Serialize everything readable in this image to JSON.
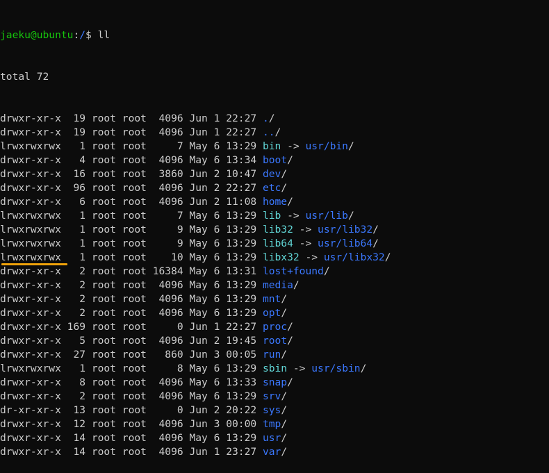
{
  "prompt": {
    "user_host": "jaeku@ubuntu",
    "separator": ":",
    "path": "/",
    "symbol": "$ ",
    "command": "ll"
  },
  "total_line": "total 72",
  "colors": {
    "background": "#0c0c0c",
    "text": "#cccccc",
    "prompt_user": "#16c60c",
    "directory": "#3b78ff",
    "symlink": "#61d6d6",
    "highlight_underline": "#f0a30a"
  },
  "entries": [
    {
      "perms": "drwxr-xr-x",
      "links": "19",
      "owner": "root",
      "group": "root",
      "size": "4096",
      "month": "Jun",
      "day": "1",
      "time": "22:27",
      "name": ".",
      "type": "dir"
    },
    {
      "perms": "drwxr-xr-x",
      "links": "19",
      "owner": "root",
      "group": "root",
      "size": "4096",
      "month": "Jun",
      "day": "1",
      "time": "22:27",
      "name": "..",
      "type": "dir"
    },
    {
      "perms": "lrwxrwxrwx",
      "links": "1",
      "owner": "root",
      "group": "root",
      "size": "7",
      "month": "May",
      "day": "6",
      "time": "13:29",
      "name": "bin",
      "type": "link",
      "target": "usr/bin"
    },
    {
      "perms": "drwxr-xr-x",
      "links": "4",
      "owner": "root",
      "group": "root",
      "size": "4096",
      "month": "May",
      "day": "6",
      "time": "13:34",
      "name": "boot",
      "type": "dir"
    },
    {
      "perms": "drwxr-xr-x",
      "links": "16",
      "owner": "root",
      "group": "root",
      "size": "3860",
      "month": "Jun",
      "day": "2",
      "time": "10:47",
      "name": "dev",
      "type": "dir"
    },
    {
      "perms": "drwxr-xr-x",
      "links": "96",
      "owner": "root",
      "group": "root",
      "size": "4096",
      "month": "Jun",
      "day": "2",
      "time": "22:27",
      "name": "etc",
      "type": "dir"
    },
    {
      "perms": "drwxr-xr-x",
      "links": "6",
      "owner": "root",
      "group": "root",
      "size": "4096",
      "month": "Jun",
      "day": "2",
      "time": "11:08",
      "name": "home",
      "type": "dir"
    },
    {
      "perms": "lrwxrwxrwx",
      "links": "1",
      "owner": "root",
      "group": "root",
      "size": "7",
      "month": "May",
      "day": "6",
      "time": "13:29",
      "name": "lib",
      "type": "link",
      "target": "usr/lib"
    },
    {
      "perms": "lrwxrwxrwx",
      "links": "1",
      "owner": "root",
      "group": "root",
      "size": "9",
      "month": "May",
      "day": "6",
      "time": "13:29",
      "name": "lib32",
      "type": "link",
      "target": "usr/lib32"
    },
    {
      "perms": "lrwxrwxrwx",
      "links": "1",
      "owner": "root",
      "group": "root",
      "size": "9",
      "month": "May",
      "day": "6",
      "time": "13:29",
      "name": "lib64",
      "type": "link",
      "target": "usr/lib64"
    },
    {
      "perms": "lrwxrwxrwx",
      "links": "1",
      "owner": "root",
      "group": "root",
      "size": "10",
      "month": "May",
      "day": "6",
      "time": "13:29",
      "name": "libx32",
      "type": "link",
      "target": "usr/libx32"
    },
    {
      "perms": "drwxr-xr-x",
      "links": "2",
      "owner": "root",
      "group": "root",
      "size": "16384",
      "month": "May",
      "day": "6",
      "time": "13:31",
      "name": "lost+found",
      "type": "dir"
    },
    {
      "perms": "drwxr-xr-x",
      "links": "2",
      "owner": "root",
      "group": "root",
      "size": "4096",
      "month": "May",
      "day": "6",
      "time": "13:29",
      "name": "media",
      "type": "dir"
    },
    {
      "perms": "drwxr-xr-x",
      "links": "2",
      "owner": "root",
      "group": "root",
      "size": "4096",
      "month": "May",
      "day": "6",
      "time": "13:29",
      "name": "mnt",
      "type": "dir"
    },
    {
      "perms": "drwxr-xr-x",
      "links": "2",
      "owner": "root",
      "group": "root",
      "size": "4096",
      "month": "May",
      "day": "6",
      "time": "13:29",
      "name": "opt",
      "type": "dir"
    },
    {
      "perms": "drwxr-xr-x",
      "links": "169",
      "owner": "root",
      "group": "root",
      "size": "0",
      "month": "Jun",
      "day": "1",
      "time": "22:27",
      "name": "proc",
      "type": "dir"
    },
    {
      "perms": "drwxr-xr-x",
      "links": "5",
      "owner": "root",
      "group": "root",
      "size": "4096",
      "month": "Jun",
      "day": "2",
      "time": "19:45",
      "name": "root",
      "type": "dir",
      "highlighted": true
    },
    {
      "perms": "drwxr-xr-x",
      "links": "27",
      "owner": "root",
      "group": "root",
      "size": "860",
      "month": "Jun",
      "day": "3",
      "time": "00:05",
      "name": "run",
      "type": "dir"
    },
    {
      "perms": "lrwxrwxrwx",
      "links": "1",
      "owner": "root",
      "group": "root",
      "size": "8",
      "month": "May",
      "day": "6",
      "time": "13:29",
      "name": "sbin",
      "type": "link",
      "target": "usr/sbin"
    },
    {
      "perms": "drwxr-xr-x",
      "links": "8",
      "owner": "root",
      "group": "root",
      "size": "4096",
      "month": "May",
      "day": "6",
      "time": "13:33",
      "name": "snap",
      "type": "dir"
    },
    {
      "perms": "drwxr-xr-x",
      "links": "2",
      "owner": "root",
      "group": "root",
      "size": "4096",
      "month": "May",
      "day": "6",
      "time": "13:29",
      "name": "srv",
      "type": "dir"
    },
    {
      "perms": "dr-xr-xr-x",
      "links": "13",
      "owner": "root",
      "group": "root",
      "size": "0",
      "month": "Jun",
      "day": "2",
      "time": "20:22",
      "name": "sys",
      "type": "dir"
    },
    {
      "perms": "drwxr-xr-x",
      "links": "12",
      "owner": "root",
      "group": "root",
      "size": "4096",
      "month": "Jun",
      "day": "3",
      "time": "00:00",
      "name": "tmp",
      "type": "dir"
    },
    {
      "perms": "drwxr-xr-x",
      "links": "14",
      "owner": "root",
      "group": "root",
      "size": "4096",
      "month": "May",
      "day": "6",
      "time": "13:29",
      "name": "usr",
      "type": "dir"
    },
    {
      "perms": "drwxr-xr-x",
      "links": "14",
      "owner": "root",
      "group": "root",
      "size": "4096",
      "month": "Jun",
      "day": "1",
      "time": "23:27",
      "name": "var",
      "type": "dir"
    }
  ]
}
